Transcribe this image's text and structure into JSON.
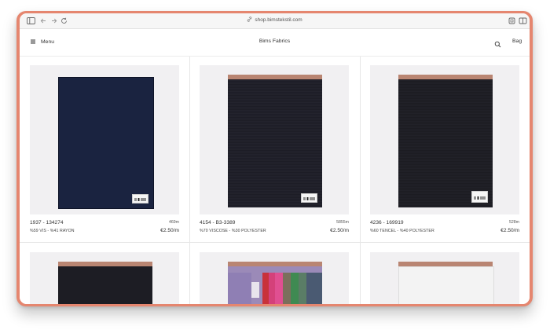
{
  "browser": {
    "url": "shop.bimstekstil.com"
  },
  "header": {
    "menu_label": "Menu",
    "brand": "Bims Fabrics",
    "bag_label": "Bag"
  },
  "products": [
    {
      "code": "1937 - 134274",
      "length": "469m",
      "composition": "%59 VIS - %41 RAYON",
      "price": "€2.50/m"
    },
    {
      "code": "4154 - B3-3389",
      "length": "5855m",
      "composition": "%70 VISCOSE - %30 POLYESTER",
      "price": "€2.50/m"
    },
    {
      "code": "4236 - 169919",
      "length": "528m",
      "composition": "%60 TENCEL - %40 POLYESTER",
      "price": "€2.50/m"
    }
  ],
  "colors": {
    "frame_accent": "#e5866f",
    "swatch_navy": "#1a2340",
    "swatch_dark": "#1d1d26",
    "swatch_charcoal": "#1c1c22",
    "swatch_white": "#f3f3f3"
  }
}
